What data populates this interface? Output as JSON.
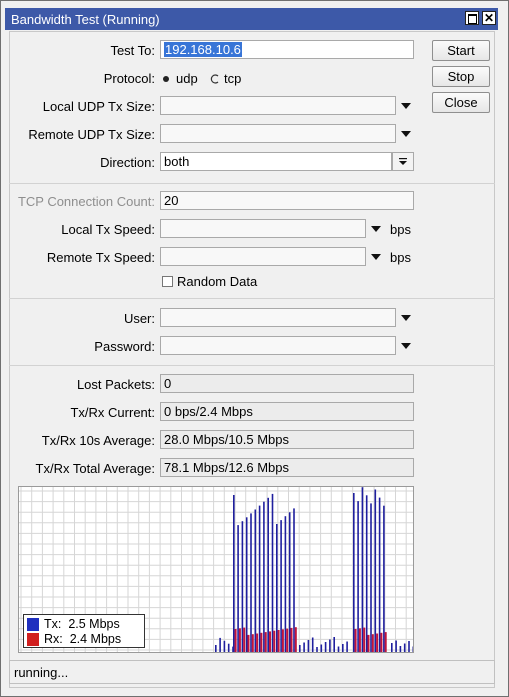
{
  "window": {
    "title": "Bandwidth Test (Running)"
  },
  "buttons": {
    "start": "Start",
    "stop": "Stop",
    "close": "Close"
  },
  "form": {
    "test_to_label": "Test To:",
    "test_to_value": "192.168.10.6",
    "protocol_label": "Protocol:",
    "protocol_options": [
      "udp",
      "tcp"
    ],
    "protocol_selected": "udp",
    "local_udp_tx_size_label": "Local UDP Tx Size:",
    "remote_udp_tx_size_label": "Remote UDP Tx Size:",
    "direction_label": "Direction:",
    "direction_value": "both",
    "tcp_connection_count_label": "TCP Connection Count:",
    "tcp_connection_count_value": "20",
    "local_tx_speed_label": "Local Tx Speed:",
    "remote_tx_speed_label": "Remote Tx Speed:",
    "speed_unit": "bps",
    "random_data_label": "Random Data",
    "random_data_checked": false,
    "user_label": "User:",
    "password_label": "Password:"
  },
  "results": {
    "lost_packets_label": "Lost Packets:",
    "lost_packets_value": "0",
    "current_label": "Tx/Rx Current:",
    "current_value": "0 bps/2.4 Mbps",
    "avg10_label": "Tx/Rx 10s Average:",
    "avg10_value": "28.0 Mbps/10.5 Mbps",
    "total_avg_label": "Tx/Rx Total Average:",
    "total_avg_value": "78.1 Mbps/12.6 Mbps"
  },
  "graph": {
    "legend": [
      {
        "name": "Tx",
        "value": "2.5 Mbps",
        "color": "#1f2fbf"
      },
      {
        "name": "Rx",
        "value": "2.4 Mbps",
        "color": "#d11f1f"
      }
    ],
    "tx_color": "#1f1f9e",
    "rx_color": "#c0143c",
    "grid_color": "#d6d6d6"
  },
  "status": {
    "text": "running..."
  }
}
